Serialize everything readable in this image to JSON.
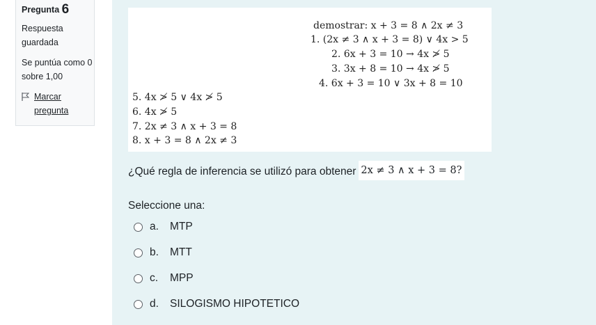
{
  "question_info": {
    "prefix": "Pregunta",
    "number": "6",
    "state": "Respuesta guardada",
    "grade": "Se puntúa como 0 sobre 1,00",
    "flag_label": "Marcar pregunta"
  },
  "proof": {
    "goal": "demostrar: x + 3 = 8 ∧ 2x ≠ 3",
    "lines": [
      "1. (2x ≠ 3 ∧ x + 3 = 8) ∨ 4x > 5",
      "2. 6x + 3 = 10 → 4x ≯ 5",
      "3. 3x + 8 = 10 → 4x ≯ 5",
      "4. 6x + 3 = 10 ∨ 3x + 8 = 10",
      "5. 4x ≯ 5 ∨ 4x ≯ 5",
      "6. 4x ≯ 5",
      "7. 2x ≠ 3 ∧ x + 3 = 8",
      "8. x + 3 = 8 ∧ 2x ≠ 3"
    ]
  },
  "question": {
    "text": "¿Qué regla de inferencia se utilizó para obtener",
    "expression": "2x ≠ 3 ∧ x + 3 = 8?"
  },
  "answer": {
    "prompt": "Seleccione una:",
    "options": [
      {
        "letter": "a.",
        "label": "MTP"
      },
      {
        "letter": "b.",
        "label": "MTT"
      },
      {
        "letter": "c.",
        "label": "MPP"
      },
      {
        "letter": "d.",
        "label": "SILOGISMO HIPOTETICO"
      }
    ]
  }
}
